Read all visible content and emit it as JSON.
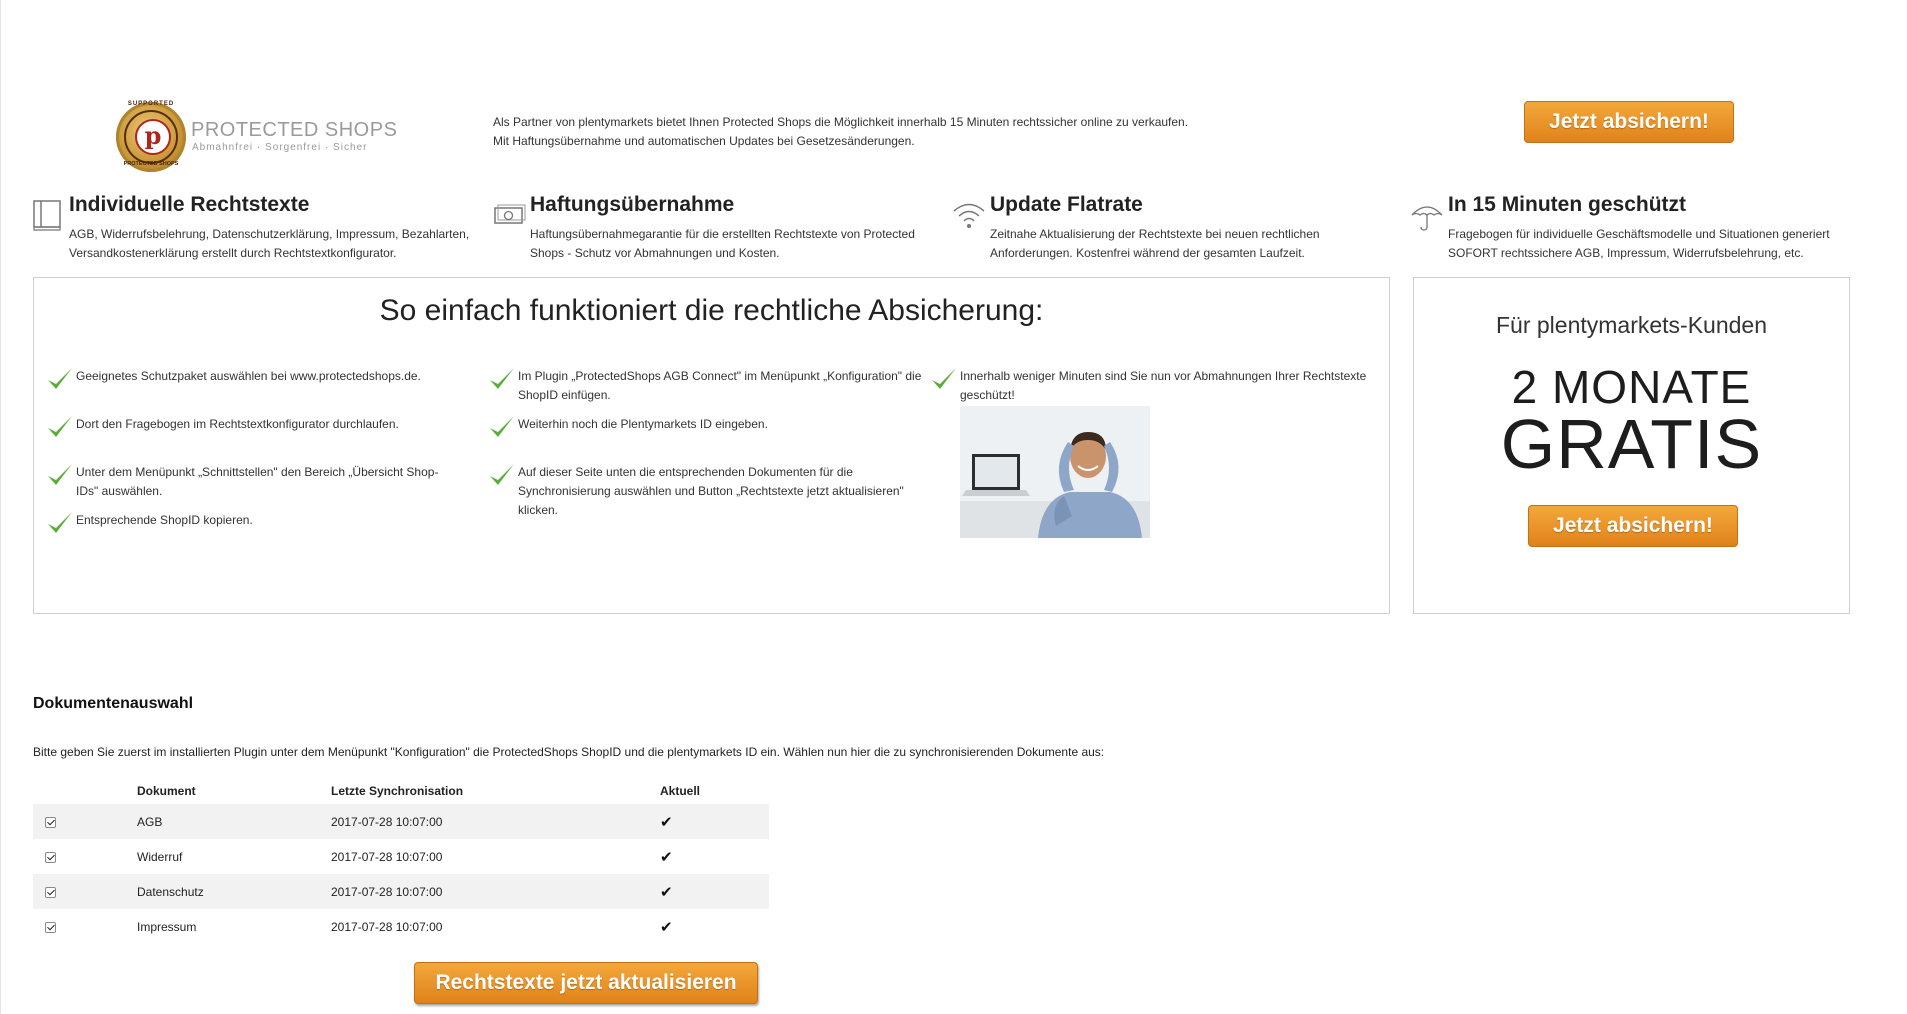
{
  "header": {
    "logo": {
      "name": "PROTECTED SHOPS",
      "tagline": "Abmahnfrei · Sorgenfrei · Sicher",
      "seal_top": "SUPPORTED",
      "seal_bottom": "PROTECTED SHOPS",
      "seal_letter": "p"
    },
    "intro_line1": "Als Partner von plentymarkets bietet Ihnen Protected Shops die Möglichkeit innerhalb 15 Minuten rechtssicher online zu verkaufen.",
    "intro_line2": "Mit Haftungsübernahme und automatischen Updates bei Gesetzesänderungen.",
    "cta_label": "Jetzt absichern!"
  },
  "features": [
    {
      "icon": "book-icon",
      "title": "Individuelle Rechtstexte",
      "text": "AGB, Widerrufsbelehrung, Datenschutzerklärung, Impressum, Bezahlarten, Versandkostenerklärung erstellt durch Rechtstextkonfigurator."
    },
    {
      "icon": "banknote-icon",
      "title": "Haftungsübernahme",
      "text": "Haftungsübernahmegarantie für die erstellten Rechtstexte von Protected Shops - Schutz vor Abmahnungen und Kosten."
    },
    {
      "icon": "wifi-icon",
      "title": "Update Flatrate",
      "text": "Zeitnahe Aktualisierung der Rechtstexte bei neuen rechtlichen Anforderungen. Kostenfrei während der gesamten Laufzeit."
    },
    {
      "icon": "umbrella-icon",
      "title": "In 15 Minuten geschützt",
      "text": "Fragebogen für individuelle Geschäftsmodelle und Situationen generiert SOFORT rechtssichere AGB, Impressum, Widerrufsbelehrung, etc."
    }
  ],
  "steps": {
    "title": "So einfach funktioniert die rechtliche Absicherung:",
    "col1": [
      "Geeignetes Schutzpaket auswählen bei www.protectedshops.de.",
      "Dort den Fragebogen im Rechtstextkonfigurator durchlaufen.",
      "Unter dem Menüpunkt „Schnittstellen\" den Bereich „Übersicht Shop-IDs\" auswählen.",
      "Entsprechende ShopID kopieren."
    ],
    "col2": [
      "Im Plugin „ProtectedShops AGB Connect\" im Menüpunkt „Konfiguration\" die ShopID einfügen.",
      "Weiterhin noch die Plentymarkets ID eingeben.",
      "Auf dieser Seite unten die entsprechenden Dokumenten für die Synchronisierung auswählen und Button „Rechtstexte jetzt aktualisieren\" klicken."
    ],
    "col3": [
      "Innerhalb weniger Minuten sind Sie nun vor Abmahnungen Ihrer Rechtstexte geschützt!"
    ]
  },
  "promo": {
    "subtitle": "Für plentymarkets-Kunden",
    "line1": "2 MONATE",
    "line2": "GRATIS",
    "cta_label": "Jetzt absichern!"
  },
  "documents": {
    "heading": "Dokumentenauswahl",
    "info": "Bitte geben Sie zuerst im installierten Plugin unter dem Menüpunkt \"Konfiguration\" die ProtectedShops ShopID und die plentymarkets ID ein. Wählen nun hier die zu synchronisierenden Dokumente aus:",
    "columns": [
      "",
      "Dokument",
      "Letzte Synchronisation",
      "Aktuell"
    ],
    "rows": [
      {
        "checked": true,
        "name": "AGB",
        "last_sync": "2017-07-28 10:07:00",
        "current": "✔"
      },
      {
        "checked": true,
        "name": "Widerruf",
        "last_sync": "2017-07-28 10:07:00",
        "current": "✔"
      },
      {
        "checked": true,
        "name": "Datenschutz",
        "last_sync": "2017-07-28 10:07:00",
        "current": "✔"
      },
      {
        "checked": true,
        "name": "Impressum",
        "last_sync": "2017-07-28 10:07:00",
        "current": "✔"
      }
    ],
    "update_label": "Rechtstexte jetzt aktualisieren"
  },
  "colors": {
    "accent_orange": "#e8901f",
    "check_green": "#5cae3c",
    "stripe": "#f2f2f2"
  }
}
